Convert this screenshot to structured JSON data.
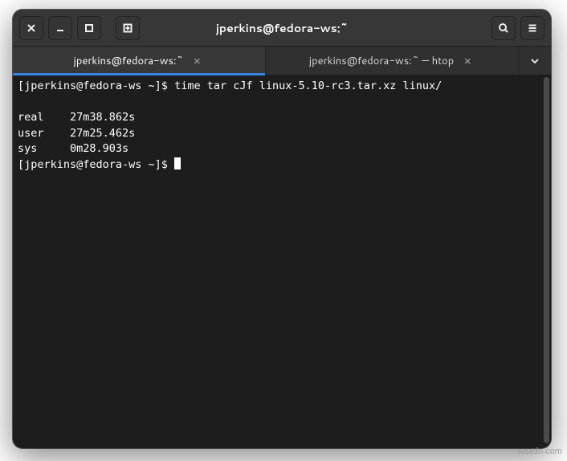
{
  "titlebar": {
    "title": "jperkins@fedora-ws:~"
  },
  "tabs": [
    {
      "label": "jperkins@fedora-ws:~",
      "active": true
    },
    {
      "label": "jperkins@fedora-ws:~ — htop",
      "active": false
    }
  ],
  "terminal": {
    "prompt": "[jperkins@fedora-ws ~]$ ",
    "command": "time tar cJf linux-5.10-rc3.tar.xz linux/",
    "output": [
      "",
      "real    27m38.862s",
      "user    27m25.462s",
      "sys     0m28.903s"
    ],
    "prompt2": "[jperkins@fedora-ws ~]$ "
  },
  "watermark": "wsxdn.com"
}
